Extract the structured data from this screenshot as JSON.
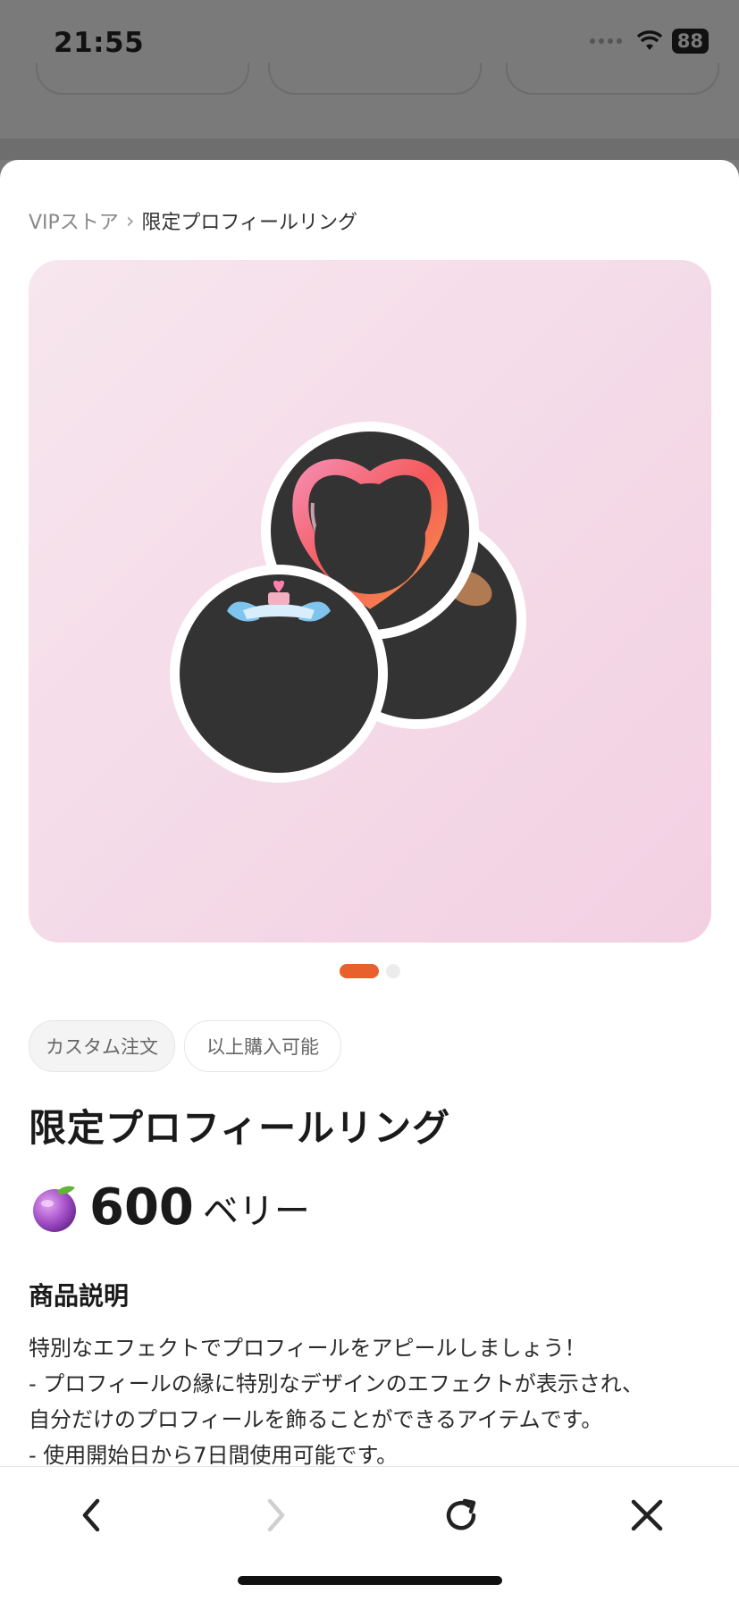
{
  "status_bar": {
    "time": "21:55",
    "battery": "88"
  },
  "breadcrumb": {
    "parent": "VIPストア",
    "current": "限定プロフィールリング"
  },
  "pager": {
    "current_page": 1,
    "total_pages": 2
  },
  "tags": [
    "カスタム注文",
    "以上購入可能"
  ],
  "product": {
    "title": "限定プロフィールリング",
    "price": "600",
    "price_unit": "ベリー",
    "currency_icon": "berry-icon"
  },
  "description": {
    "heading": "商品説明",
    "lines": [
      "特別なエフェクトでプロフィールをアピールしましょう！",
      "- プロフィールの縁に特別なデザインのエフェクトが表示され、",
      "自分だけのプロフィールを飾ることができるアイテムです。",
      "- 使用開始日から7日間使用可能です。"
    ]
  },
  "toolbar": {
    "back_icon": "chevron-left-icon",
    "forward_icon": "chevron-right-icon",
    "reload_icon": "reload-icon",
    "close_icon": "close-icon"
  },
  "colors": {
    "accent": "#e8602c",
    "hero_bg": "#f2d0e2"
  }
}
